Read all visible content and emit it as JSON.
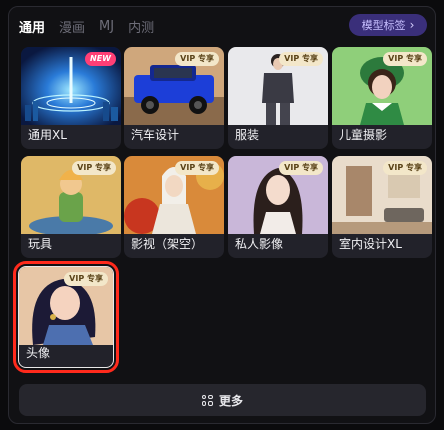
{
  "tabs": [
    {
      "label": "通用",
      "active": true
    },
    {
      "label": "漫画",
      "active": false
    },
    {
      "label": "MJ",
      "active": false
    },
    {
      "label": "内测",
      "active": false
    }
  ],
  "model_tag": {
    "label": "模型标签",
    "icon": "chevron-right-icon"
  },
  "cards": [
    {
      "label": "通用XL",
      "badge": "NEW"
    },
    {
      "label": "汽车设计",
      "badge": "VIP 专享"
    },
    {
      "label": "服装",
      "badge": "VIP 专享"
    },
    {
      "label": "儿童摄影",
      "badge": "VIP 专享"
    },
    {
      "label": "玩具",
      "badge": "VIP 专享"
    },
    {
      "label": "影视（架空）",
      "badge": "VIP 专享"
    },
    {
      "label": "私人影像",
      "badge": "VIP 专享"
    },
    {
      "label": "室内设计XL",
      "badge": "VIP 专享"
    },
    {
      "label": "头像",
      "badge": "VIP 专享",
      "selected": true
    }
  ],
  "more_button": {
    "label": "更多",
    "icon": "grid-icon"
  },
  "colors": {
    "accent": "#3a2f7a",
    "selection": "#ff2a1c",
    "vip_badge": "#f3e7c9",
    "new_badge": "#ff3f76"
  }
}
